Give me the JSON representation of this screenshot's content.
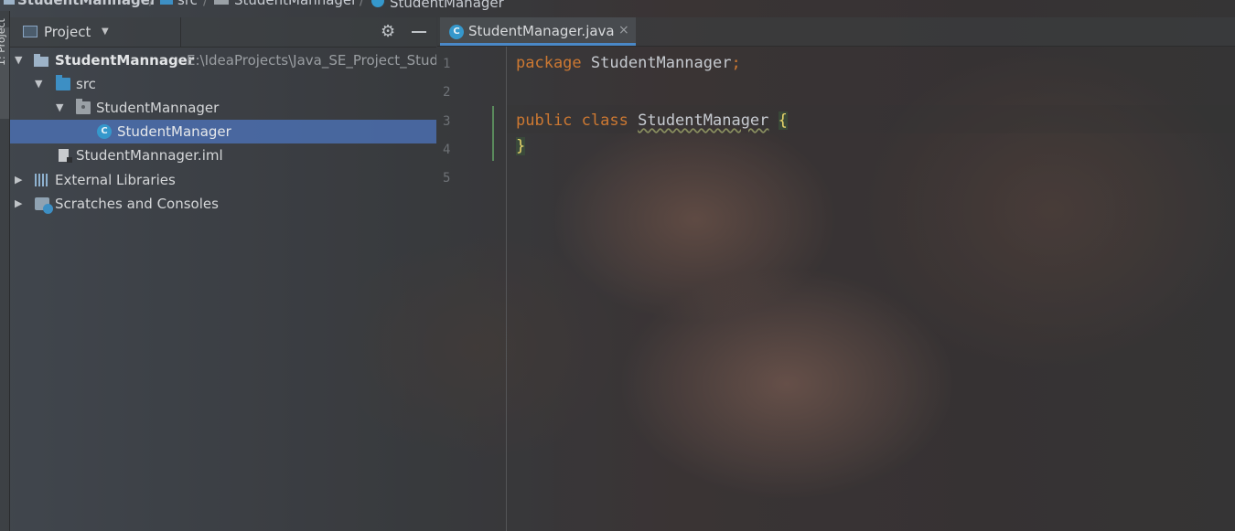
{
  "breadcrumb": {
    "items": [
      "StudentMannager",
      "src",
      "StudentMannager",
      "StudentManager"
    ]
  },
  "left_stripe": {
    "tab_label": "1: Project"
  },
  "project_panel": {
    "title": "Project",
    "tree": [
      {
        "label": "StudentMannager",
        "path": "E:\\IdeaProjects\\Java_SE_Project_Stude",
        "icon": "module-folder-icon"
      },
      {
        "label": "src",
        "icon": "source-folder-icon"
      },
      {
        "label": "StudentMannager",
        "icon": "package-folder-icon"
      },
      {
        "label": "StudentManager",
        "icon": "java-class-icon",
        "selected": true
      },
      {
        "label": "StudentMannager.iml",
        "icon": "iml-file-icon"
      },
      {
        "label": "External Libraries",
        "icon": "libraries-icon"
      },
      {
        "label": "Scratches and Consoles",
        "icon": "scratches-icon"
      }
    ]
  },
  "editor": {
    "tab": {
      "label": "StudentManager.java",
      "icon_letter": "C",
      "close": "×"
    },
    "line_numbers": [
      "1",
      "2",
      "3",
      "4",
      "5"
    ],
    "code": {
      "line1": {
        "keyword": "package",
        "name": "StudentMannager",
        "semicolon": ";"
      },
      "line3": {
        "kw1": "public",
        "kw2": "class",
        "name": "StudentManager",
        "brace": "{"
      },
      "line4": {
        "brace": "}"
      }
    }
  },
  "colors": {
    "selection": "#4b6eaf",
    "keyword": "#cc7832",
    "class_icon": "#3598cc",
    "tab_underline": "#4a88c7"
  }
}
